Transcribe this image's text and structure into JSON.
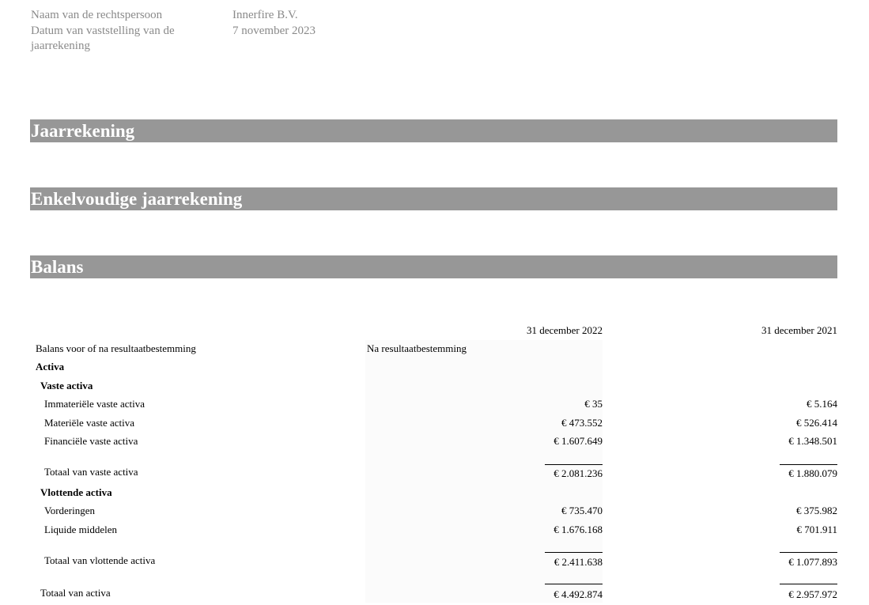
{
  "meta": {
    "rows": [
      {
        "label": "Naam van de rechtspersoon",
        "value": "Innerfire B.V."
      },
      {
        "label": "Datum van vaststelling van de jaarrekening",
        "value": "7 november 2023"
      }
    ]
  },
  "headings": [
    "Jaarrekening",
    "Enkelvoudige jaarrekening",
    "Balans"
  ],
  "balance": {
    "col1_header": "31 december 2022",
    "col2_header": "31 december 2021",
    "basis_label": "Balans voor of na resultaatbestemming",
    "basis_value": "Na resultaatbestemming",
    "activa": "Activa",
    "vaste_activa": "Vaste activa",
    "vaste_rows": [
      {
        "label": "Immateriële vaste activa",
        "v2022": "€ 35",
        "v2021": "€ 5.164"
      },
      {
        "label": "Materiële vaste activa",
        "v2022": "€ 473.552",
        "v2021": "€ 526.414"
      },
      {
        "label": "Financiële vaste activa",
        "v2022": "€ 1.607.649",
        "v2021": "€ 1.348.501"
      }
    ],
    "vaste_total": {
      "label": "Totaal van vaste activa",
      "v2022": "€ 2.081.236",
      "v2021": "€ 1.880.079"
    },
    "vlottende_activa": "Vlottende activa",
    "vlottende_rows": [
      {
        "label": "Vorderingen",
        "v2022": "€ 735.470",
        "v2021": "€ 375.982"
      },
      {
        "label": "Liquide middelen",
        "v2022": "€ 1.676.168",
        "v2021": "€ 701.911"
      }
    ],
    "vlottende_total": {
      "label": "Totaal van vlottende activa",
      "v2022": "€ 2.411.638",
      "v2021": "€ 1.077.893"
    },
    "activa_total": {
      "label": "Totaal van activa",
      "v2022": "€ 4.492.874",
      "v2021": "€ 2.957.972"
    }
  }
}
